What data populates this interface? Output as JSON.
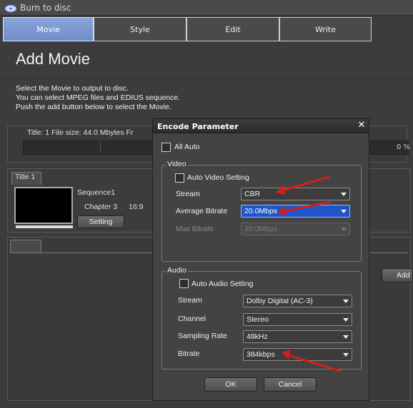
{
  "window": {
    "title": "Burn to disc"
  },
  "tabs": [
    {
      "label": "Movie"
    },
    {
      "label": "Style"
    },
    {
      "label": "Edit"
    },
    {
      "label": "Write"
    }
  ],
  "page": {
    "title": "Add Movie",
    "instructions": [
      "Select the Movie to output to disc.",
      "You can select MPEG files and EDIUS sequence.",
      "Push the add button below to select the Movie."
    ]
  },
  "info_bar": {
    "text": "Title: 1    File size: 44.0 Mbytes    Fr",
    "progress_label": "0 %",
    "progress_value": 0
  },
  "title_panel": {
    "tab_label": "Title 1",
    "sequence_name": "Sequence1",
    "chapter": "Chapter 3",
    "aspect": "16:9",
    "setting_button": "Setting"
  },
  "add_button": "Add",
  "dialog": {
    "title": "Encode Parameter",
    "close": "✕",
    "all_auto_label": "All Auto",
    "all_auto_checked": false,
    "video": {
      "group_label": "Video",
      "auto_label": "Auto Video Setting",
      "auto_checked": false,
      "stream_label": "Stream",
      "stream_value": "CBR",
      "avg_bitrate_label": "Average Bitrate",
      "avg_bitrate_value": "20.0Mbps",
      "max_bitrate_label": "Max Bitrate",
      "max_bitrate_value": "20.0Mbps"
    },
    "audio": {
      "group_label": "Audio",
      "auto_label": "Auto Audio Setting",
      "auto_checked": false,
      "stream_label": "Stream",
      "stream_value": "Dolby Digital (AC-3)",
      "channel_label": "Channel",
      "channel_value": "Stereo",
      "sampling_label": "Sampling Rate",
      "sampling_value": "48kHz",
      "bitrate_label": "Bitrate",
      "bitrate_value": "384kbps"
    },
    "ok_label": "OK",
    "cancel_label": "Cancel"
  },
  "colors": {
    "active_tab": "#7b96cf",
    "highlight": "#1f55c8",
    "annotation_arrow": "#d21f1f"
  }
}
